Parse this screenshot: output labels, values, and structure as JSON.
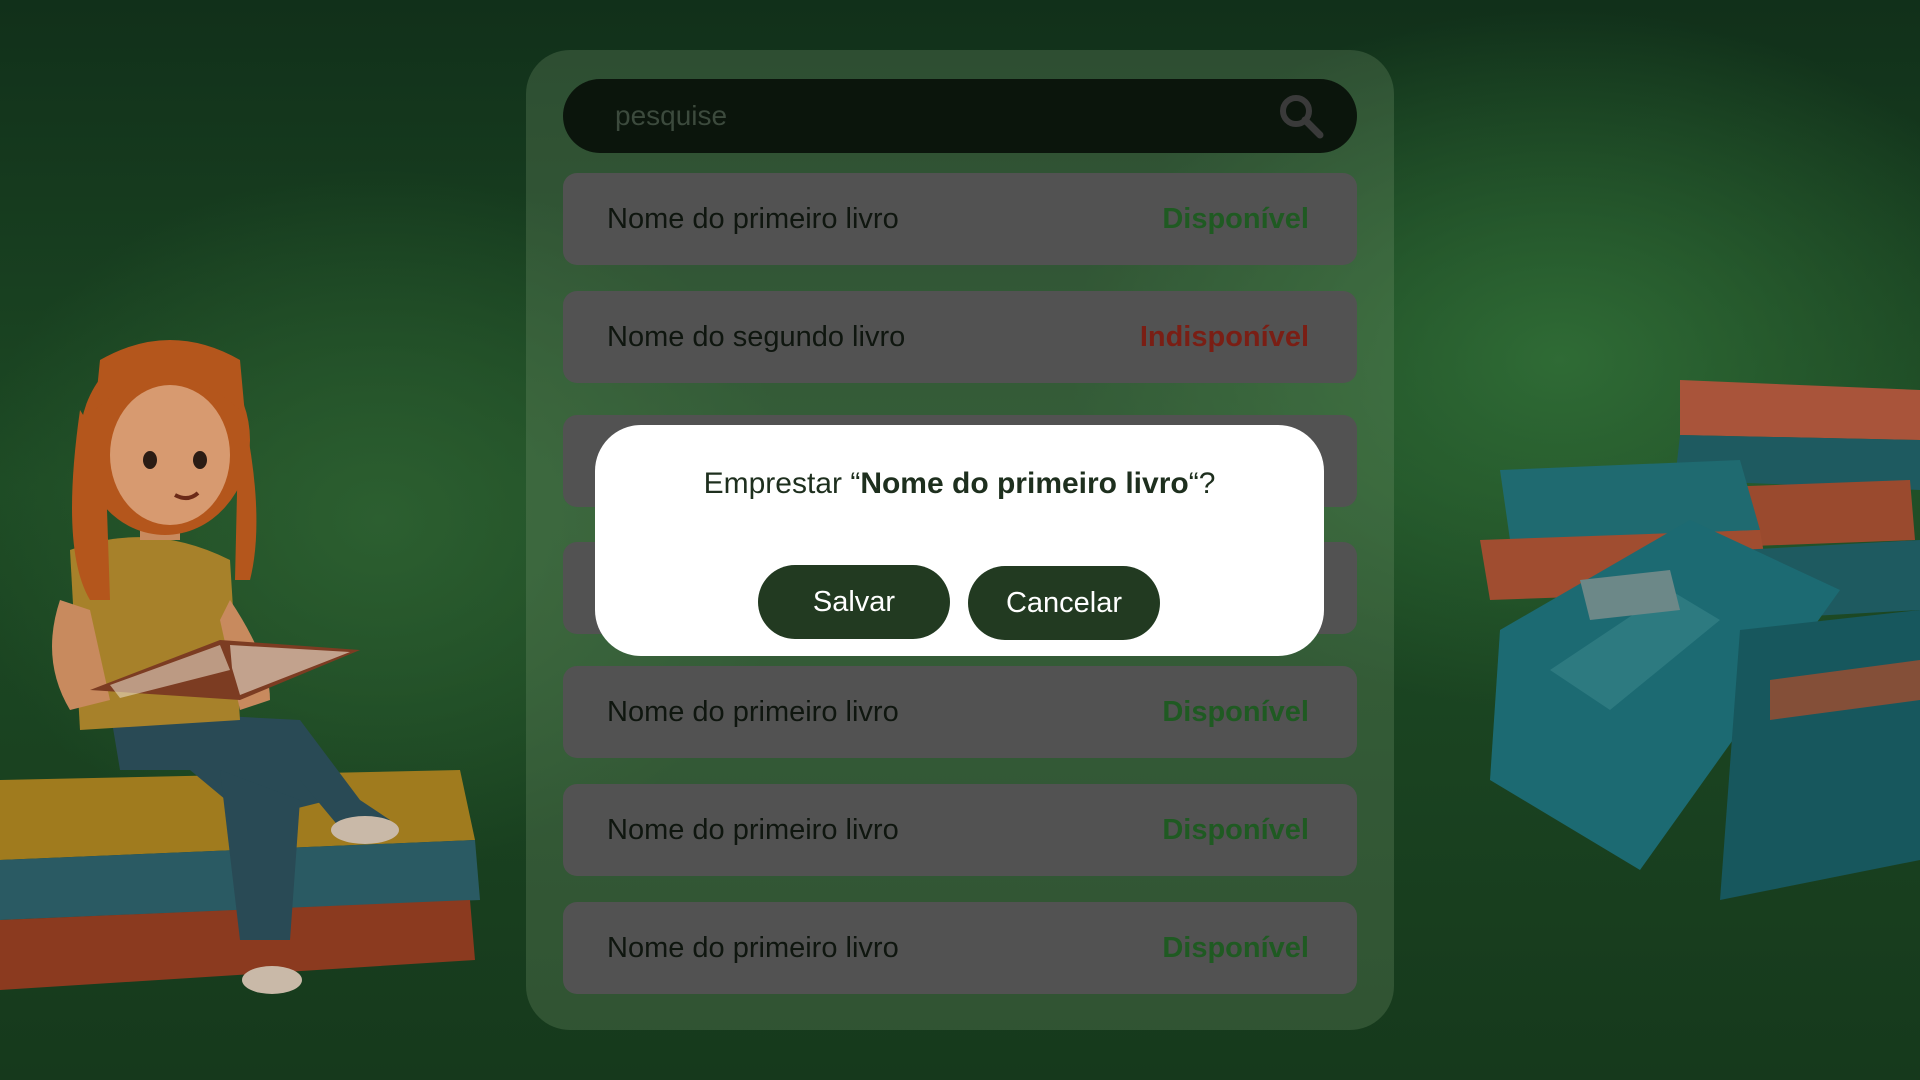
{
  "search": {
    "placeholder": "pesquise",
    "icon": "search-icon"
  },
  "books": [
    {
      "title": "Nome do primeiro livro",
      "status": "Disponível",
      "available": true
    },
    {
      "title": "Nome do segundo livro",
      "status": "Indisponível",
      "available": false
    },
    {
      "title": "",
      "status": "",
      "available": true
    },
    {
      "title": "",
      "status": "",
      "available": true
    },
    {
      "title": "Nome do primeiro livro",
      "status": "Disponível",
      "available": true
    },
    {
      "title": "Nome do primeiro livro",
      "status": "Disponível",
      "available": true
    },
    {
      "title": "Nome do primeiro livro",
      "status": "Disponível",
      "available": true
    }
  ],
  "modal": {
    "prefix": "Emprestar “",
    "book_title": "Nome do primeiro livro",
    "suffix": "“?",
    "save_label": "Salvar",
    "cancel_label": "Cancelar"
  },
  "colors": {
    "available": "#1f5a22",
    "unavailable": "#7a1e14",
    "button": "#223a21",
    "row_background": "#525252"
  }
}
